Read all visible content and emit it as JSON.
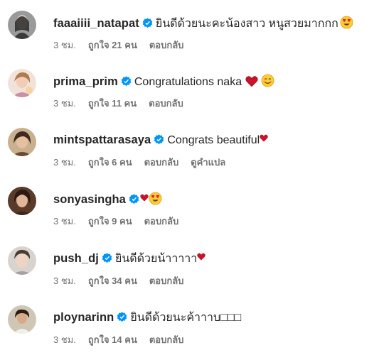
{
  "comments": [
    {
      "username": "faaaiiii_natapat",
      "text": "ยินดีด้วยนะคะน้องสาว หนูสวยมากกก",
      "emoji": "heart-eyes",
      "time": "3 ชม.",
      "likes": "ถูกใจ 21 คน",
      "reply": "ตอบกลับ",
      "translate": ""
    },
    {
      "username": "prima_prim",
      "text": "Congratulations naka",
      "emoji": "heart-smile",
      "time": "3 ชม.",
      "likes": "ถูกใจ 11 คน",
      "reply": "ตอบกลับ",
      "translate": ""
    },
    {
      "username": "mintspattarasaya",
      "text": "Congrats beautiful",
      "emoji": "heart",
      "time": "3 ชม.",
      "likes": "ถูกใจ 6 คน",
      "reply": "ตอบกลับ",
      "translate": "ดูคำแปล"
    },
    {
      "username": "sonyasingha",
      "text": "",
      "emoji": "heart-heart-eyes",
      "time": "3 ชม.",
      "likes": "ถูกใจ 9 คน",
      "reply": "ตอบกลับ",
      "translate": ""
    },
    {
      "username": "push_dj",
      "text": "ยินดีด้วยน้าาาาา",
      "emoji": "heart",
      "time": "3 ชม.",
      "likes": "ถูกใจ 34 คน",
      "reply": "ตอบกลับ",
      "translate": ""
    },
    {
      "username": "ploynarinn",
      "text": "ยินดีด้วยนะค้าาาบ□□□",
      "emoji": "",
      "time": "3 ชม.",
      "likes": "ถูกใจ 14 คน",
      "reply": "ตอบกลับ",
      "translate": ""
    }
  ],
  "colors": {
    "username": "#262626",
    "meta": "#737373",
    "verified": "#0095f6",
    "heart": "#d0112b",
    "emoji_face": "#ffcc33"
  }
}
